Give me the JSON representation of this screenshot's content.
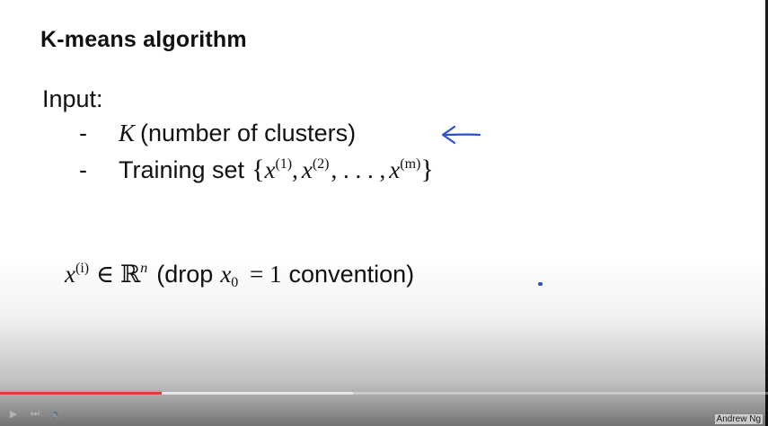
{
  "slide": {
    "title": "K-means algorithm",
    "input_label": "Input:",
    "bullets": {
      "dash": "-",
      "k_symbol": "K",
      "k_text": "(number of clusters)",
      "training_text": "Training set",
      "set_open": "{",
      "x1": "x",
      "x1_sup": "(1)",
      "comma1": ",",
      "x2": "x",
      "x2_sup": "(2)",
      "ellipsis": ", . . . ,",
      "xm": "x",
      "xm_sup": "(m)",
      "set_close": "}"
    },
    "bottom": {
      "xi": "x",
      "xi_sup": "(i)",
      "in_rn": "∈ ℝ",
      "rn_sup": "n",
      "drop_open": "(drop",
      "x0": "x",
      "x0_sub": "0",
      "eq": "= 1",
      "convention": "convention)"
    },
    "watermark": "Andrew Ng"
  },
  "annotations": {
    "arrow_color": "#2a4fd6"
  },
  "player": {
    "progress": 0.21,
    "buffered": 0.46,
    "progress_color": "#e53935"
  }
}
